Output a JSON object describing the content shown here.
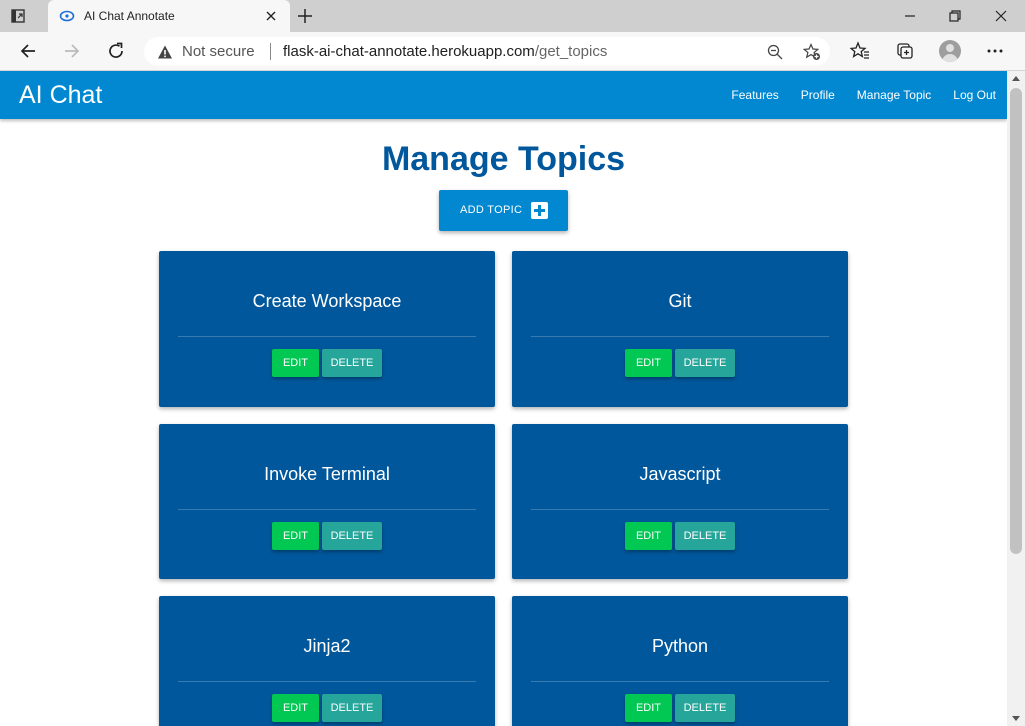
{
  "browser": {
    "tab_title": "AI Chat Annotate",
    "security_label": "Not secure",
    "url_host": "flask-ai-chat-annotate.herokuapp.com",
    "url_path": "/get_topics"
  },
  "app": {
    "brand": "AI Chat",
    "nav": [
      "Features",
      "Profile",
      "Manage Topic",
      "Log Out"
    ]
  },
  "page": {
    "heading": "Manage Topics",
    "add_button_label": "ADD TOPIC",
    "edit_label": "EDIT",
    "delete_label": "DELETE",
    "topics": [
      "Create Workspace",
      "Git",
      "Invoke Terminal",
      "Javascript",
      "Jinja2",
      "Python"
    ]
  },
  "colors": {
    "navbar": "#0288d1",
    "card": "#01579b",
    "edit_button": "#00c853",
    "delete_button": "#26a69a"
  }
}
